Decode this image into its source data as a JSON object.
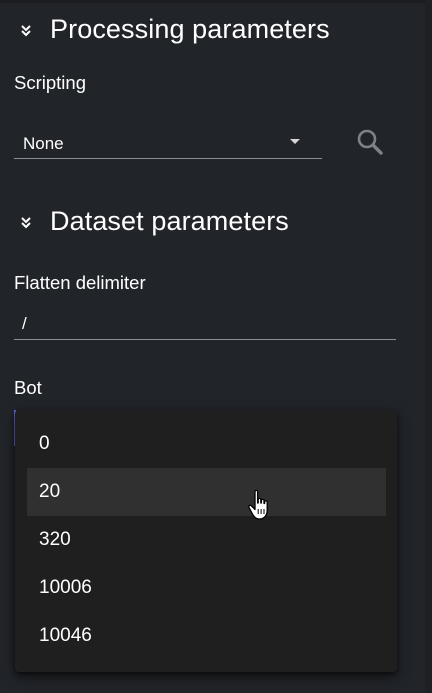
{
  "processing": {
    "title": "Processing parameters",
    "scripting_label": "Scripting",
    "scripting_value": "None"
  },
  "dataset": {
    "title": "Dataset parameters",
    "flatten_label": "Flatten delimiter",
    "flatten_value": "/",
    "bot_label": "Bot",
    "bot_options": [
      "0",
      "20",
      "320",
      "10006",
      "10046"
    ],
    "bot_hovered_option": "20"
  },
  "icons": {
    "collapse": "chevrons-down-icon",
    "search": "search-icon",
    "caret": "caret-down-icon",
    "cursor": "hand-pointer-icon"
  },
  "colors": {
    "background": "#212429",
    "dropdown_bg": "#1f1f1f",
    "hover_bg": "#303030",
    "accent": "#5b6be0",
    "underline": "#8a8d92"
  }
}
